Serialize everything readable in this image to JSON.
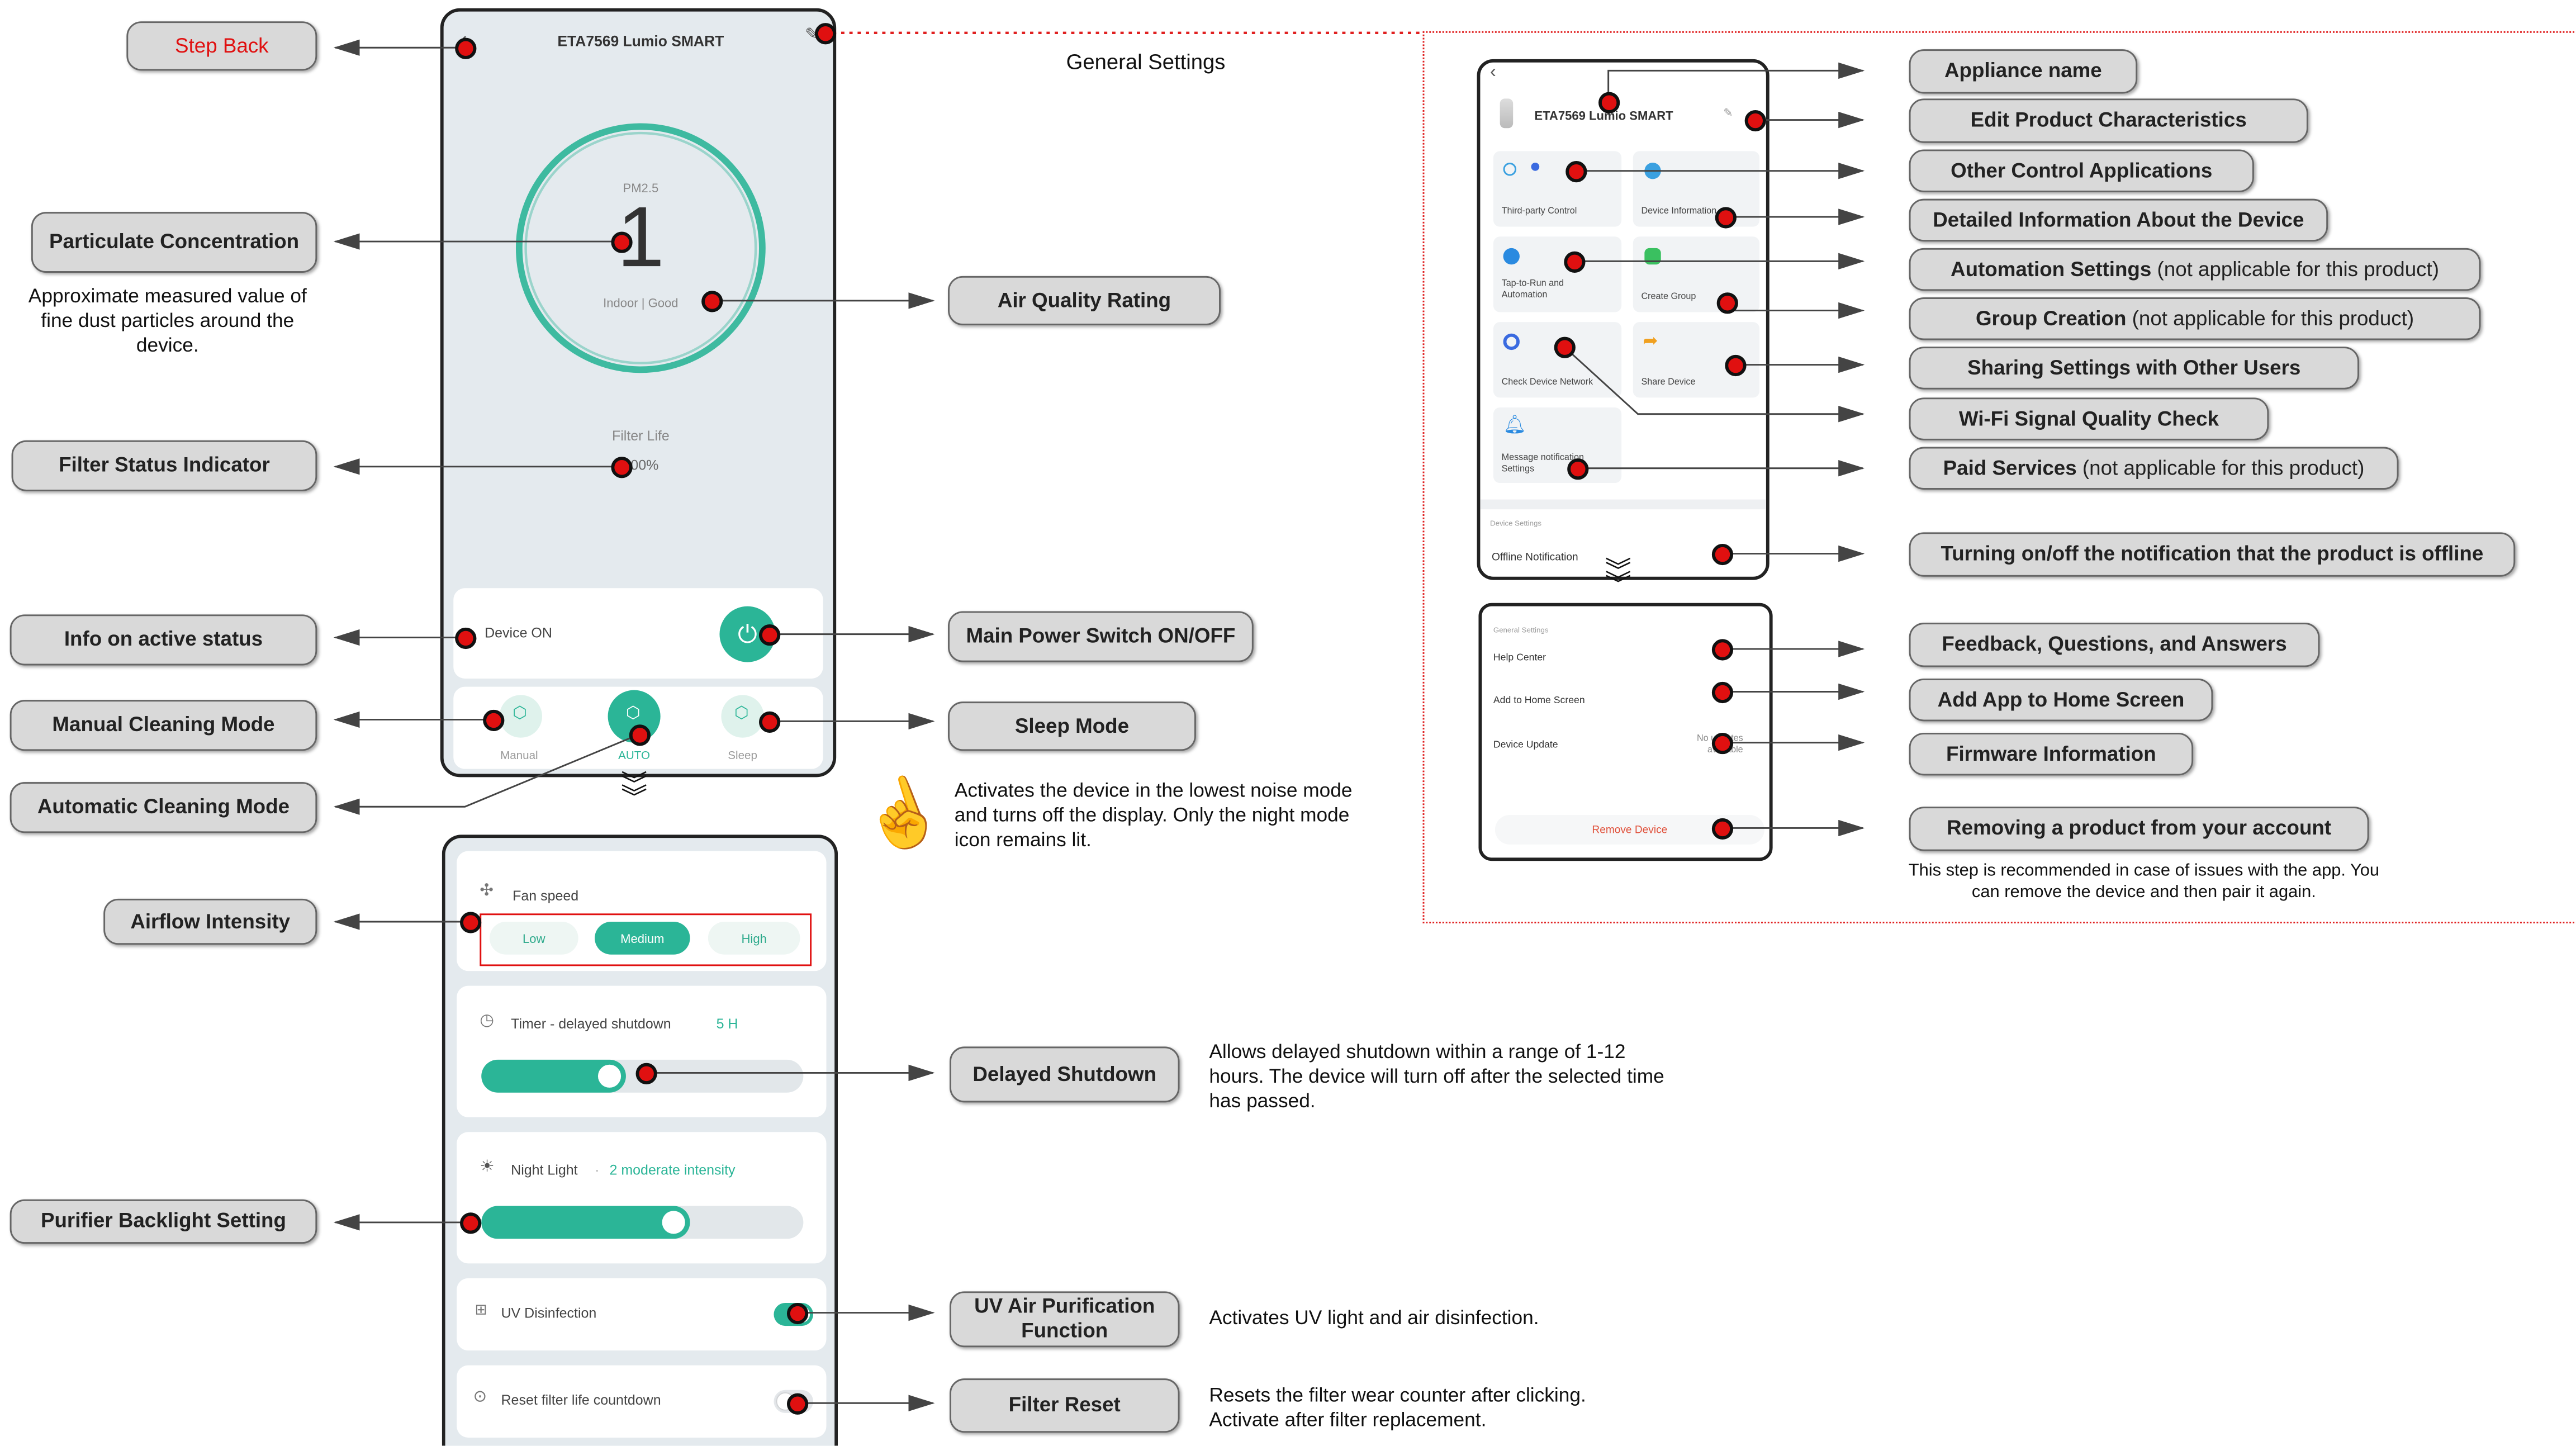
{
  "title_general": "General Settings",
  "left_labels": {
    "step_back": "Step Back",
    "particulate": "Particulate Concentration",
    "particulate_desc": "Approximate measured value of fine dust particles around the device.",
    "filter_status": "Filter Status Indicator",
    "info_active": "Info on active status",
    "manual_mode": "Manual Cleaning Mode",
    "auto_mode": "Automatic Cleaning Mode",
    "airflow": "Airflow Intensity",
    "backlight": "Purifier Backlight Setting"
  },
  "mid_labels": {
    "air_quality": "Air Quality Rating",
    "power_switch": "Main Power Switch ON/OFF",
    "sleep_mode": "Sleep Mode",
    "sleep_desc": "Activates the device in the lowest noise mode and turns off the display. Only the night mode icon remains lit.",
    "delayed_shutdown": "Delayed Shutdown",
    "delayed_desc": "Allows delayed shutdown within a range of  1-12 hours. The device will turn off after the selected time has passed.",
    "uv_function": "UV Air Purification Function",
    "uv_desc": "Activates UV light and air disinfection.",
    "filter_reset": "Filter Reset",
    "filter_reset_desc": "Resets the filter wear counter after clicking. Activate after filter replacement."
  },
  "right_labels": {
    "appliance_name": "Appliance name",
    "edit_product": "Edit Product Characteristics",
    "other_control": "Other Control Applications",
    "detailed_info": "Detailed Information About the Device",
    "automation_bold": "Automation Settings",
    "automation_note": "(not applicable for this product)",
    "group_bold": "Group Creation",
    "group_note": "(not applicable for this product)",
    "sharing": "Sharing Settings with Other Users",
    "wifi": "Wi-Fi Signal Quality Check",
    "paid_bold": "Paid Services",
    "paid_note": "(not applicable for this product)",
    "offline_notif": "Turning on/off the notification that the product is offline",
    "feedback": "Feedback, Questions, and Answers",
    "add_app": "Add App to Home Screen",
    "firmware": "Firmware Information",
    "removing": "Removing a product from your account",
    "removing_desc": "This step is recommended in case of issues with the app. You can remove the device and then pair it again."
  },
  "phone_main": {
    "title": "ETA7569 Lumio SMART",
    "pm_label": "PM2.5",
    "pm_value": "1",
    "quality": "Indoor | Good",
    "filter_label": "Filter Life",
    "filter_value": "100%",
    "device_on": "Device ON",
    "mode_manual": "Manual",
    "mode_auto": "AUTO",
    "mode_sleep": "Sleep"
  },
  "phone_settings": {
    "fan_speed": "Fan speed",
    "speed_low": "Low",
    "speed_medium": "Medium",
    "speed_high": "High",
    "timer_label": "Timer - delayed shutdown",
    "timer_value": "5 H",
    "timer_level": 0.45,
    "night_label": "Night Light",
    "night_value": "2 moderate intensity",
    "night_level": 0.65,
    "uv_label": "UV Disinfection",
    "uv_on": true,
    "reset_label": "Reset filter life countdown",
    "reset_on": false
  },
  "phone_general": {
    "title": "ETA7569 Lumio SMART",
    "tile_third_party": "Third-party Control",
    "tile_device_info": "Device Information",
    "tile_tap_to_run": "Tap-to-Run and Automation",
    "tile_create_group": "Create Group",
    "tile_check_network": "Check Device Network",
    "tile_share": "Share Device",
    "tile_message": "Message notification Settings",
    "section_device": "Device Settings",
    "offline": "Offline Notification"
  },
  "phone_general2": {
    "section": "General Settings",
    "help": "Help Center",
    "add_home": "Add to Home Screen",
    "update": "Device Update",
    "update_status": "No updates available",
    "remove": "Remove Device"
  },
  "colors": {
    "accent": "#2bb597",
    "dot": "#e01010",
    "remove": "#e0503a",
    "dashed_border": "#e02020"
  }
}
